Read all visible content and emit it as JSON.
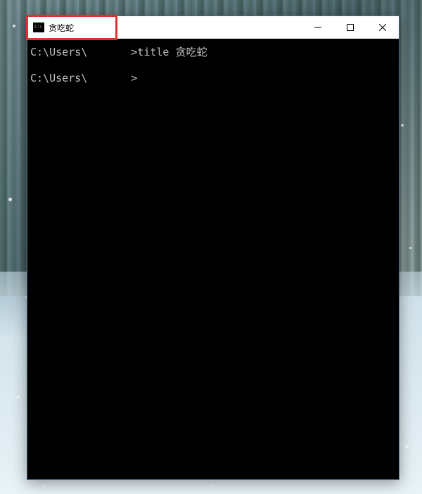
{
  "window": {
    "title": "贪吃蛇",
    "icon_label": "C:\\"
  },
  "terminal": {
    "lines": [
      {
        "prefix": "C:\\Users\\",
        "redacted": true,
        "suffix": ">title 贪吃蛇"
      },
      {
        "prefix": "C:\\Users\\",
        "redacted": true,
        "suffix": ">"
      }
    ]
  }
}
